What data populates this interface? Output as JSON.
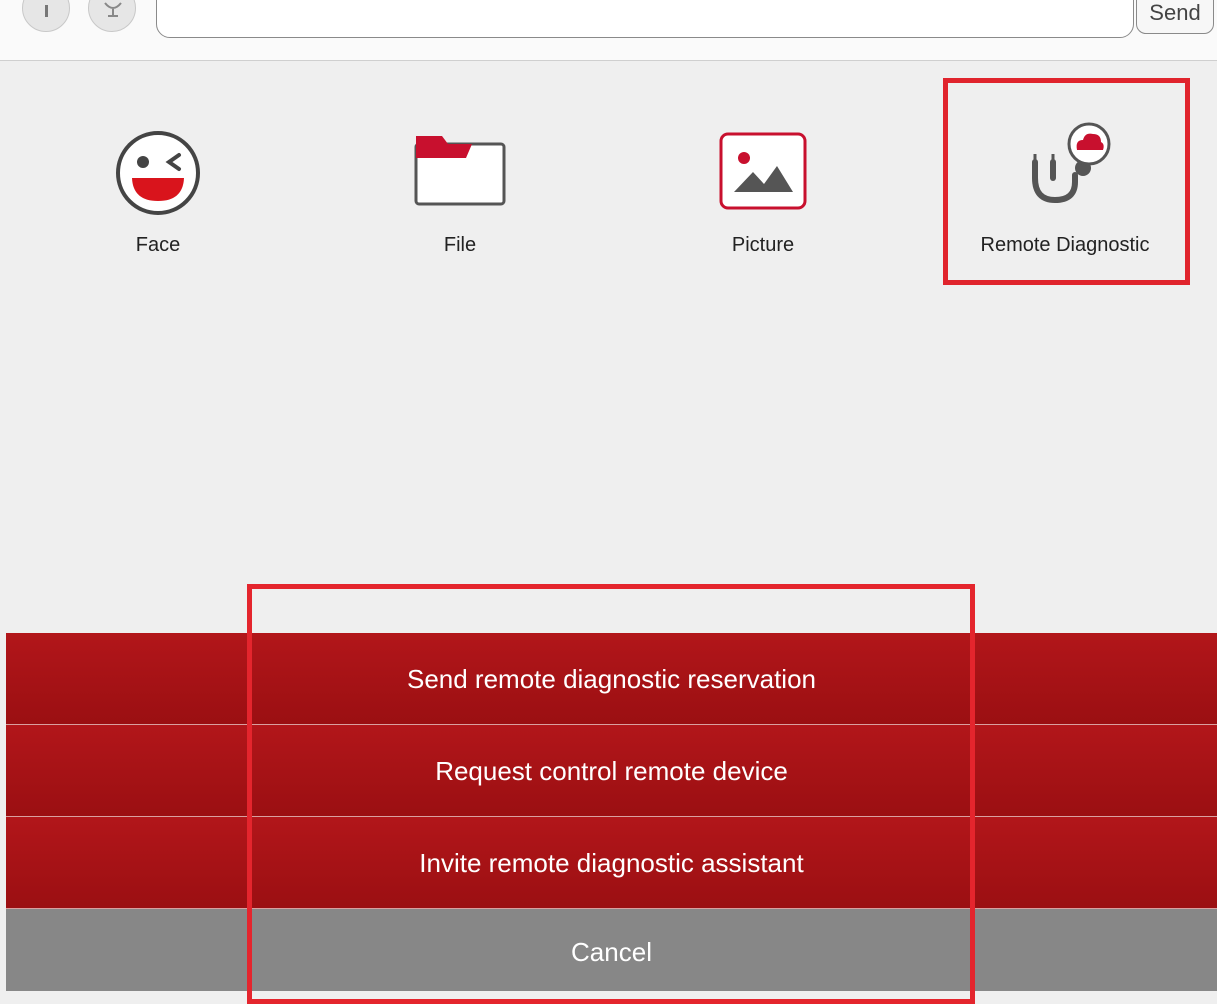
{
  "composer": {
    "send_label": "Send"
  },
  "apps": [
    {
      "label": "Face",
      "icon": "face-icon"
    },
    {
      "label": "File",
      "icon": "folder-icon"
    },
    {
      "label": "Picture",
      "icon": "picture-icon"
    },
    {
      "label": "Remote Diagnostic",
      "icon": "stethoscope-cloud-icon"
    }
  ],
  "action_sheet": {
    "items": [
      "Send remote diagnostic reservation",
      "Request control remote device",
      "Invite remote diagnostic assistant"
    ],
    "cancel_label": "Cancel"
  },
  "colors": {
    "accent_red": "#c8102e",
    "sheet_red": "#a81215",
    "highlight_red": "#e0242d",
    "cancel_gray": "#878787"
  }
}
